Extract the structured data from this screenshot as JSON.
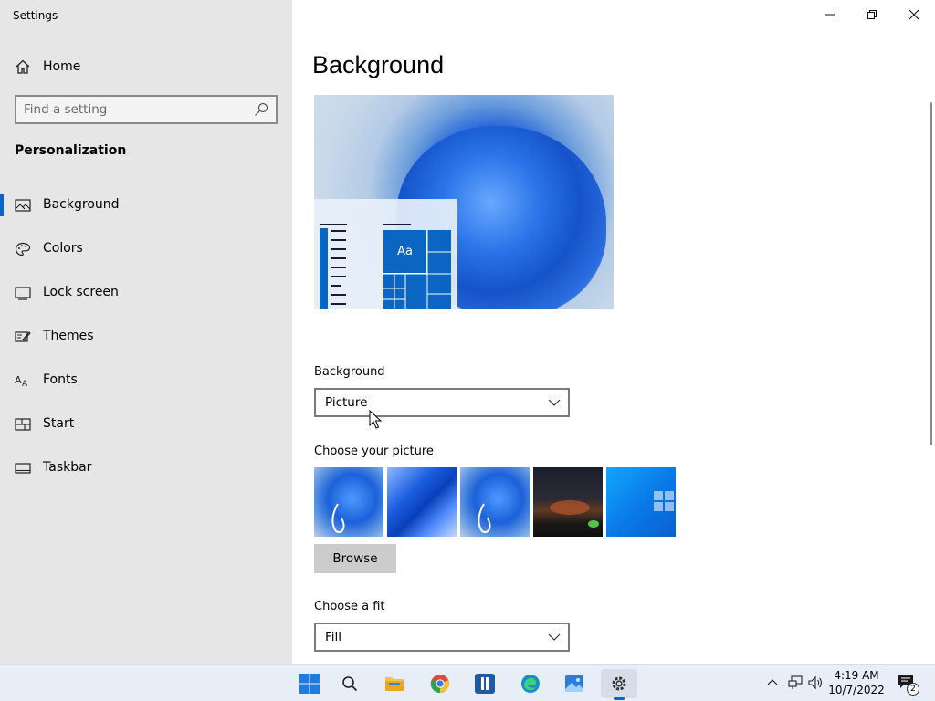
{
  "window": {
    "title": "Settings"
  },
  "sidebar": {
    "home_label": "Home",
    "search_placeholder": "Find a setting",
    "section_title": "Personalization",
    "items": [
      {
        "label": "Background",
        "icon": "image-icon",
        "active": true
      },
      {
        "label": "Colors",
        "icon": "palette-icon"
      },
      {
        "label": "Lock screen",
        "icon": "lock-screen-icon"
      },
      {
        "label": "Themes",
        "icon": "themes-icon"
      },
      {
        "label": "Fonts",
        "icon": "fonts-icon"
      },
      {
        "label": "Start",
        "icon": "start-icon"
      },
      {
        "label": "Taskbar",
        "icon": "taskbar-icon"
      }
    ]
  },
  "main": {
    "title": "Background",
    "preview": {
      "tile_text": "Aa"
    },
    "background_label": "Background",
    "background_value": "Picture",
    "choose_picture_label": "Choose your picture",
    "browse_label": "Browse",
    "choose_fit_label": "Choose a fit",
    "fit_value": "Fill"
  },
  "taskbar": {
    "time": "4:19 AM",
    "date": "10/7/2022",
    "notification_count": "2"
  },
  "colors": {
    "accent": "#0a66c2",
    "sidebar_bg": "#e6e6e6",
    "taskbar_bg": "#e8eef7"
  }
}
